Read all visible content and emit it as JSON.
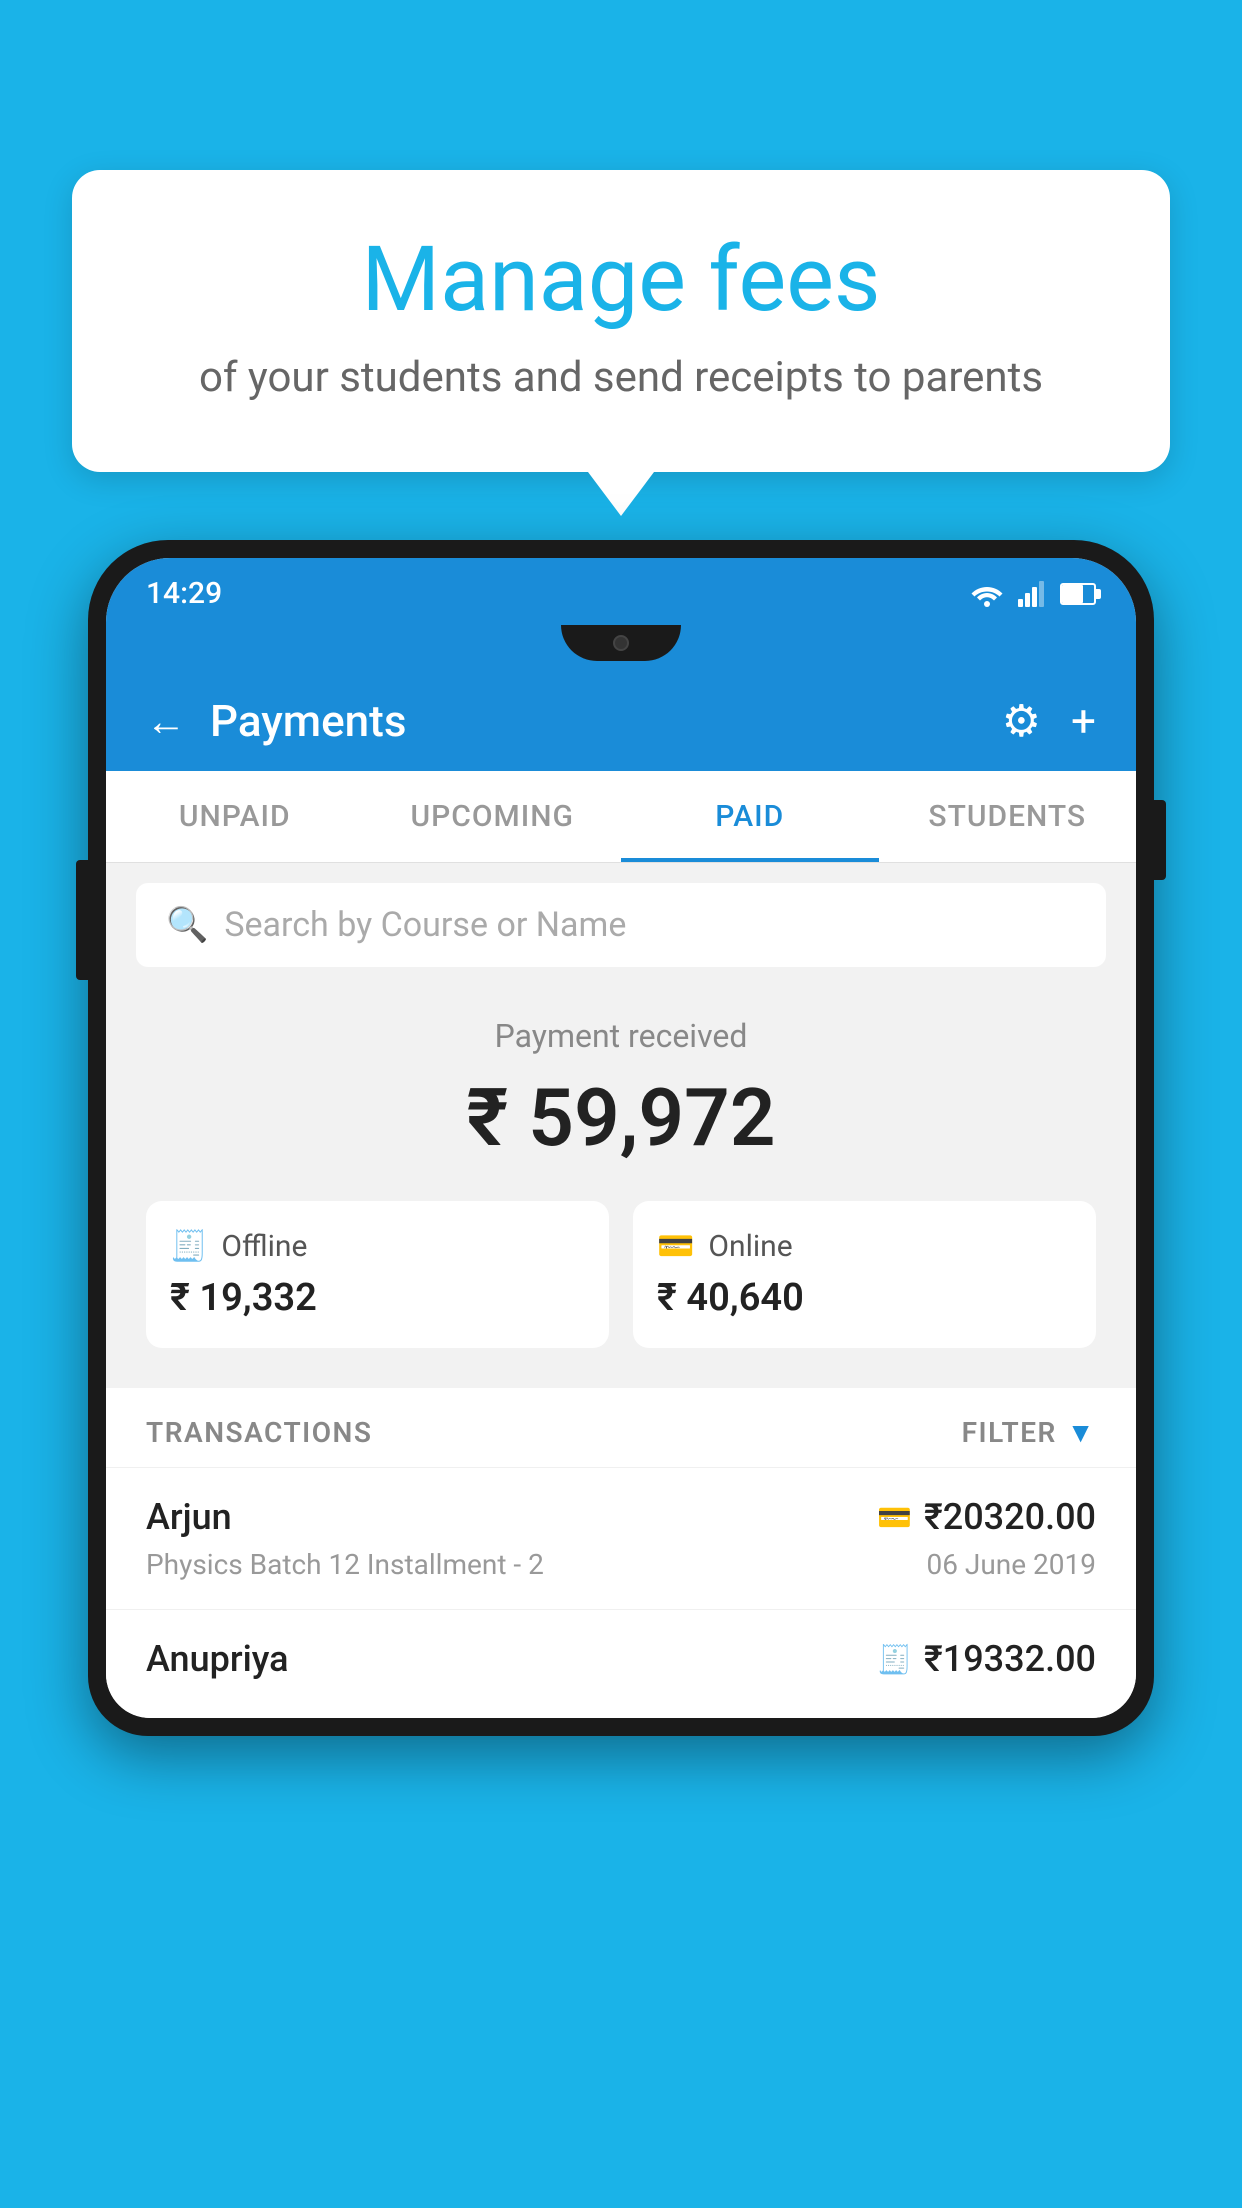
{
  "page": {
    "background_color": "#1ab3e8"
  },
  "speech_bubble": {
    "title": "Manage fees",
    "subtitle": "of your students and send receipts to parents"
  },
  "status_bar": {
    "time": "14:29"
  },
  "header": {
    "title": "Payments",
    "back_label": "←",
    "gear_label": "⚙",
    "plus_label": "+"
  },
  "tabs": [
    {
      "label": "UNPAID",
      "active": false
    },
    {
      "label": "UPCOMING",
      "active": false
    },
    {
      "label": "PAID",
      "active": true
    },
    {
      "label": "STUDENTS",
      "active": false
    }
  ],
  "search": {
    "placeholder": "Search by Course or Name"
  },
  "payment_summary": {
    "label": "Payment received",
    "total": "₹ 59,972",
    "offline": {
      "type": "Offline",
      "amount": "₹ 19,332"
    },
    "online": {
      "type": "Online",
      "amount": "₹ 40,640"
    }
  },
  "transactions_section": {
    "label": "TRANSACTIONS",
    "filter_label": "FILTER"
  },
  "transactions": [
    {
      "name": "Arjun",
      "description": "Physics Batch 12 Installment - 2",
      "amount": "₹20320.00",
      "date": "06 June 2019",
      "type_icon": "card"
    },
    {
      "name": "Anupriya",
      "description": "",
      "amount": "₹19332.00",
      "date": "",
      "type_icon": "cash"
    }
  ]
}
